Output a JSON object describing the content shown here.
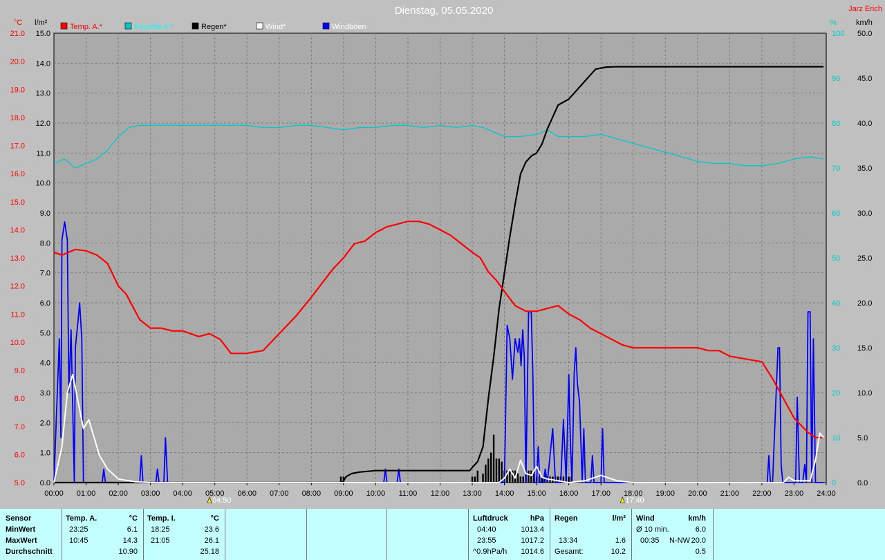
{
  "chart_data": {
    "type": "line",
    "title": "Dienstag, 05.05.2020",
    "author": "Jarz Erich",
    "axes": {
      "temp": {
        "unit": "°C",
        "ylim": [
          5.0,
          21.0
        ],
        "ticks": [
          "5.0",
          "6.0",
          "7.0",
          "8.0",
          "9.0",
          "10.0",
          "11.0",
          "12.0",
          "13.0",
          "14.0",
          "15.0",
          "16.0",
          "17.0",
          "18.0",
          "19.0",
          "20.0",
          "21.0"
        ],
        "color": "#ff0000"
      },
      "rain": {
        "unit": "l/m²",
        "ylim": [
          0.0,
          15.0
        ],
        "ticks": [
          "0.0",
          "1.0",
          "2.0",
          "3.0",
          "4.0",
          "5.0",
          "6.0",
          "7.0",
          "8.0",
          "9.0",
          "10.0",
          "11.0",
          "12.0",
          "13.0",
          "14.0",
          "15.0"
        ],
        "color": "#000000"
      },
      "humidity": {
        "unit": "%",
        "ylim": [
          0,
          100
        ],
        "ticks": [
          "0",
          "10",
          "20",
          "30",
          "40",
          "50",
          "60",
          "70",
          "80",
          "90",
          "100"
        ],
        "color": "#00c8c8"
      },
      "wind": {
        "unit": "km/h",
        "ylim": [
          0.0,
          50.0
        ],
        "ticks": [
          "0.0",
          "5.0",
          "10.0",
          "15.0",
          "20.0",
          "25.0",
          "30.0",
          "35.0",
          "40.0",
          "45.0",
          "50.0"
        ],
        "color": "#000000"
      },
      "x_ticks": [
        "00:00",
        "01:00",
        "02:00",
        "03:00",
        "04:00",
        "05:00",
        "06:00",
        "07:00",
        "08:00",
        "09:00",
        "10:00",
        "11:00",
        "12:00",
        "13:00",
        "14:00",
        "15:00",
        "16:00",
        "17:00",
        "18:00",
        "19:00",
        "20:00",
        "21:00",
        "22:00",
        "23:00",
        "24:00"
      ],
      "xlim": [
        "00:00",
        "24:00"
      ]
    },
    "sun_markers": [
      {
        "time": "04:50",
        "label": "04:50",
        "kind": "sunrise"
      },
      {
        "time": "17:40",
        "label": "17:40",
        "kind": "sunset"
      }
    ],
    "grid": true,
    "legend_position": "top-left",
    "series": [
      {
        "name": "Temp. A.*",
        "axis": "temp",
        "color": "#ff0000",
        "x": [
          "00:00",
          "00:15",
          "00:40",
          "01:00",
          "01:20",
          "01:40",
          "02:00",
          "02:15",
          "02:40",
          "03:00",
          "03:20",
          "03:40",
          "04:00",
          "04:15",
          "04:30",
          "04:50",
          "05:10",
          "05:30",
          "05:45",
          "06:00",
          "06:30",
          "06:55",
          "07:10",
          "07:30",
          "08:00",
          "08:20",
          "08:40",
          "09:00",
          "09:20",
          "09:40",
          "10:00",
          "10:20",
          "10:40",
          "10:50",
          "11:00",
          "11:20",
          "11:40",
          "12:00",
          "12:20",
          "12:40",
          "13:00",
          "13:15",
          "13:30",
          "13:45",
          "14:00",
          "14:20",
          "14:40",
          "15:00",
          "15:20",
          "15:40",
          "16:00",
          "16:20",
          "16:40",
          "17:00",
          "17:20",
          "17:40",
          "18:00",
          "18:30",
          "19:00",
          "19:30",
          "20:00",
          "20:20",
          "20:40",
          "21:00",
          "21:30",
          "22:00",
          "22:20",
          "22:40",
          "23:00",
          "23:25",
          "23:40",
          "23:55"
        ],
        "y": [
          13.2,
          13.1,
          13.3,
          13.25,
          13.1,
          12.8,
          12.0,
          11.7,
          10.8,
          10.5,
          10.5,
          10.4,
          10.4,
          10.3,
          10.2,
          10.3,
          10.1,
          9.6,
          9.6,
          9.6,
          9.7,
          10.2,
          10.5,
          10.9,
          11.6,
          12.1,
          12.6,
          13.0,
          13.5,
          13.6,
          13.9,
          14.1,
          14.2,
          14.25,
          14.3,
          14.3,
          14.2,
          14.0,
          13.8,
          13.5,
          13.2,
          13.0,
          12.5,
          12.2,
          11.8,
          11.3,
          11.1,
          11.1,
          11.2,
          11.3,
          11.0,
          10.8,
          10.5,
          10.3,
          10.1,
          9.9,
          9.8,
          9.8,
          9.8,
          9.8,
          9.8,
          9.7,
          9.7,
          9.5,
          9.4,
          9.3,
          8.7,
          8.0,
          7.3,
          6.8,
          6.6,
          6.6
        ],
        "line_width": 2.2
      },
      {
        "name": "Feuchte A.*",
        "axis": "humidity",
        "color": "#00c8c8",
        "x": [
          "00:00",
          "00:20",
          "00:40",
          "01:00",
          "01:20",
          "01:40",
          "02:00",
          "02:20",
          "02:40",
          "03:00",
          "03:30",
          "04:00",
          "04:30",
          "05:00",
          "05:30",
          "06:00",
          "06:30",
          "07:00",
          "07:30",
          "08:00",
          "08:30",
          "09:00",
          "09:30",
          "10:00",
          "10:30",
          "11:00",
          "11:30",
          "12:00",
          "12:30",
          "13:00",
          "13:20",
          "13:40",
          "14:00",
          "14:30",
          "15:00",
          "15:20",
          "15:40",
          "16:00",
          "16:30",
          "17:00",
          "17:30",
          "18:00",
          "18:30",
          "19:00",
          "19:30",
          "20:00",
          "20:30",
          "21:00",
          "21:30",
          "22:00",
          "22:30",
          "23:00",
          "23:30",
          "23:55"
        ],
        "y": [
          71,
          72,
          70,
          71,
          72,
          74,
          77,
          79,
          79.5,
          79.5,
          79.5,
          79.5,
          79.5,
          79.5,
          79.5,
          79.5,
          79,
          79,
          79.5,
          79.5,
          79,
          78.5,
          79,
          79,
          79.5,
          79.5,
          79,
          79.5,
          79,
          79.5,
          79,
          78,
          77,
          77,
          77.5,
          78.5,
          77,
          77,
          77,
          77.5,
          76.5,
          75.5,
          74.5,
          73.5,
          72.5,
          71.5,
          71,
          71,
          70.5,
          70.5,
          71,
          72,
          72.5,
          72
        ],
        "line_width": 1.3
      },
      {
        "name": "Regen*",
        "axis": "rain",
        "color": "#000000",
        "x": [
          "00:00",
          "08:58",
          "09:05",
          "09:15",
          "09:30",
          "10:00",
          "10:30",
          "11:00",
          "11:30",
          "12:00",
          "12:30",
          "12:55",
          "13:00",
          "13:10",
          "13:20",
          "13:30",
          "13:40",
          "13:50",
          "14:00",
          "14:10",
          "14:20",
          "14:30",
          "14:40",
          "14:50",
          "15:00",
          "15:10",
          "15:20",
          "15:30",
          "15:40",
          "16:00",
          "16:20",
          "16:40",
          "16:50",
          "17:10",
          "17:30",
          "18:00",
          "19:00",
          "20:00",
          "21:00",
          "22:00",
          "23:00",
          "23:55"
        ],
        "y": [
          0,
          0,
          0.2,
          0.3,
          0.35,
          0.4,
          0.4,
          0.4,
          0.4,
          0.4,
          0.4,
          0.4,
          0.5,
          0.7,
          1.2,
          2.8,
          4.2,
          5.8,
          7.0,
          8.2,
          9.3,
          10.3,
          10.7,
          10.9,
          11.0,
          11.3,
          11.8,
          12.2,
          12.6,
          12.8,
          13.2,
          13.6,
          13.8,
          13.87,
          13.88,
          13.88,
          13.88,
          13.88,
          13.88,
          13.88,
          13.88,
          13.88
        ],
        "line_width": 2.2
      },
      {
        "name": "Wind*",
        "axis": "wind",
        "color": "#ffffff",
        "x": [
          "00:00",
          "00:15",
          "00:25",
          "00:35",
          "00:45",
          "00:55",
          "01:05",
          "01:15",
          "01:25",
          "01:40",
          "02:00",
          "02:30",
          "03:00",
          "13:50",
          "14:00",
          "14:10",
          "14:20",
          "14:30",
          "14:40",
          "14:50",
          "15:00",
          "15:10",
          "15:20",
          "15:40",
          "16:00",
          "16:30",
          "16:50",
          "17:00",
          "17:30",
          "18:00",
          "22:40",
          "22:50",
          "23:00",
          "23:30",
          "23:40",
          "23:48",
          "23:55"
        ],
        "y": [
          0,
          4,
          10,
          12,
          9,
          6,
          7,
          5,
          3,
          1.5,
          0.4,
          0.1,
          0,
          0,
          0.5,
          1.5,
          0.5,
          2.5,
          1,
          0.8,
          1.8,
          0.6,
          0.4,
          0.2,
          0,
          0.2,
          0.6,
          0.8,
          0.2,
          0,
          0,
          0.6,
          0.2,
          0.2,
          2.5,
          5.5,
          5.0
        ],
        "line_width": 2.0
      },
      {
        "name": "Windböen",
        "axis": "wind",
        "color": "#0000ff",
        "x": [
          "00:00",
          "00:10",
          "00:13",
          "00:15",
          "00:20",
          "00:25",
          "00:28",
          "00:32",
          "00:38",
          "00:40",
          "00:45",
          "00:48",
          "00:52",
          "00:55",
          "01:00",
          "01:02",
          "01:05",
          "01:08",
          "01:10",
          "01:15",
          "01:20",
          "01:25",
          "01:30",
          "01:33",
          "01:36",
          "01:40",
          "02:40",
          "02:43",
          "02:46",
          "02:50",
          "03:10",
          "03:13",
          "03:16",
          "03:20",
          "03:25",
          "03:28",
          "03:32",
          "03:35",
          "10:15",
          "10:18",
          "10:21",
          "10:25",
          "10:40",
          "10:43",
          "10:46",
          "10:50",
          "14:00",
          "14:05",
          "14:10",
          "14:15",
          "14:20",
          "14:25",
          "14:28",
          "14:31",
          "14:34",
          "14:37",
          "14:40",
          "14:45",
          "14:50",
          "14:53",
          "14:56",
          "15:00",
          "15:03",
          "15:06",
          "15:10",
          "15:13",
          "15:16",
          "15:20",
          "15:25",
          "15:30",
          "15:35",
          "15:40",
          "15:45",
          "15:50",
          "15:55",
          "16:00",
          "16:03",
          "16:06",
          "16:10",
          "16:13",
          "16:16",
          "16:20",
          "16:25",
          "16:28",
          "16:31",
          "16:35",
          "16:38",
          "16:41",
          "16:44",
          "16:47",
          "16:50",
          "16:55",
          "17:00",
          "17:03",
          "17:06",
          "17:10",
          "17:13",
          "17:16",
          "17:20",
          "17:23",
          "17:26",
          "17:30",
          "22:10",
          "22:13",
          "22:16",
          "22:20",
          "22:30",
          "22:33",
          "22:36",
          "22:39",
          "22:42",
          "22:45",
          "22:50",
          "23:00",
          "23:03",
          "23:06",
          "23:10",
          "23:13",
          "23:16",
          "23:20",
          "23:23",
          "23:26",
          "23:30",
          "23:33",
          "23:36",
          "23:40",
          "23:43",
          "23:46",
          "23:50",
          "23:53",
          "23:55"
        ],
        "y": [
          0,
          16,
          5,
          27,
          29,
          27,
          10,
          17,
          0,
          15,
          18,
          20,
          16,
          0,
          0,
          0,
          0,
          0,
          0,
          0,
          0,
          0,
          0,
          1.5,
          0,
          0,
          0,
          3,
          0,
          0,
          0,
          1.5,
          0,
          0,
          0,
          5,
          0,
          0,
          0,
          1.5,
          0,
          0,
          0,
          1.5,
          0,
          0,
          0,
          17.5,
          16,
          11.5,
          16,
          14.5,
          16,
          13,
          17,
          14,
          0,
          19,
          19,
          12,
          0,
          0,
          4,
          0,
          0,
          0,
          1.5,
          0,
          3,
          6,
          0,
          0,
          0,
          7,
          0,
          12,
          4.5,
          0,
          12,
          15,
          11,
          9,
          0,
          6,
          0,
          0,
          0,
          0,
          3,
          0,
          0,
          0,
          0,
          6,
          0,
          0,
          0,
          0,
          0,
          0,
          0,
          0,
          0,
          3,
          0,
          0,
          15,
          15,
          2,
          0,
          0,
          0,
          0,
          0,
          0,
          9.5,
          0,
          0,
          0,
          2,
          0,
          19,
          19,
          0,
          16,
          0,
          0,
          0,
          0,
          0,
          0
        ],
        "line_width": 1.8
      }
    ],
    "rain_bars": {
      "x": [
        "08:55",
        "09:00",
        "13:00",
        "13:05",
        "13:10",
        "13:20",
        "13:25",
        "13:30",
        "13:35",
        "13:40",
        "13:45",
        "13:50",
        "13:55",
        "14:00",
        "14:05",
        "14:10",
        "14:15",
        "14:20",
        "14:25",
        "14:30",
        "14:35",
        "14:40",
        "14:45",
        "14:50",
        "14:55",
        "15:00",
        "15:05",
        "15:10",
        "15:15",
        "15:20",
        "15:25",
        "15:30",
        "15:35",
        "15:40",
        "15:45",
        "15:50",
        "15:55",
        "16:00",
        "16:05"
      ],
      "y": [
        0.2,
        0.2,
        0.2,
        0.2,
        0.4,
        0.3,
        0.6,
        0.8,
        1.0,
        1.6,
        0.8,
        0.8,
        0.7,
        0.4,
        0.4,
        0.4,
        0.4,
        0.4,
        0.3,
        0.2,
        0.2,
        0.3,
        0.4,
        0.4,
        0.3,
        0.2,
        0.2,
        0.2,
        0.3,
        0.2,
        0.2,
        0.2,
        0.2,
        0.2,
        0.2,
        0.2,
        0.2,
        0.2,
        0.2
      ]
    }
  },
  "stats": {
    "sensor": {
      "header": "Sensor",
      "rows": [
        "MinWert",
        "MaxWert",
        "Durchschnitt"
      ]
    },
    "temp_a": {
      "header": "Temp. A.",
      "unit": "°C",
      "min_time": "23:25",
      "min_val": "6.1",
      "max_time": "10:45",
      "max_val": "14.3",
      "avg_val": "10.90"
    },
    "temp_i": {
      "header": "Temp. I.",
      "unit": "°C",
      "min_time": "18:25",
      "min_val": "23.6",
      "max_time": "21:05",
      "max_val": "26.1",
      "avg_val": "25.18"
    },
    "pressure": {
      "header": "Luftdruck",
      "unit": "hPa",
      "min_time": "04:40",
      "min_val": "1013.4",
      "max_time": "23:55",
      "max_val": "1017.2",
      "avg_time": "^0.9hPa/h",
      "avg_val": "1014.6"
    },
    "rain": {
      "header": "Regen",
      "unit": "l/m²",
      "max_time": "13:34",
      "max_val": "1.6",
      "avg_time": "Gesamt:",
      "avg_val": "10.2"
    },
    "wind": {
      "header": "Wind",
      "unit": "km/h",
      "min_time": "Ø 10 min.",
      "min_val": "6.0",
      "max_time": "00:35",
      "max_dir": "N-NW",
      "max_val": "20.0",
      "avg_val": "0.5"
    }
  }
}
